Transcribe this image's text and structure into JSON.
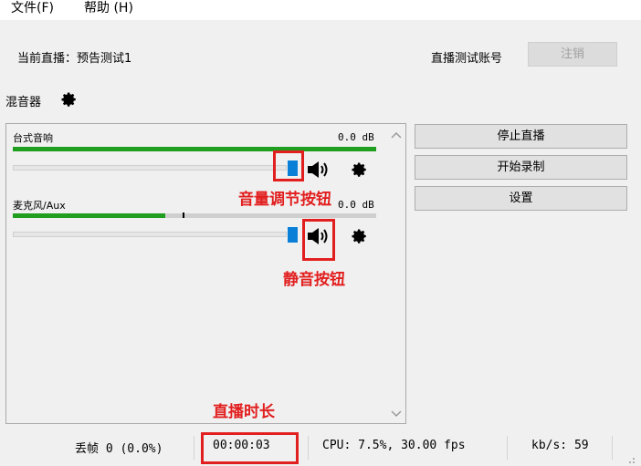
{
  "menu": {
    "file": "文件(F)",
    "help": "帮助 (H)"
  },
  "header": {
    "current_stream": "当前直播：预告测试1",
    "account_label": "直播测试账号",
    "logout_button": "注销"
  },
  "mixer": {
    "title": "混音器",
    "tracks": [
      {
        "name": "台式音响",
        "db": "0.0 dB",
        "level": 1.0
      },
      {
        "name": "麦克风/Aux",
        "db": "0.0 dB",
        "level": 0.42
      }
    ]
  },
  "buttons": {
    "stop_stream": "停止直播",
    "start_record": "开始录制",
    "settings": "设置"
  },
  "annotations": {
    "volume": "音量调节按钮",
    "mute": "静音按钮",
    "duration": "直播时长"
  },
  "status": {
    "dropped_frames": "丢帧 0 (0.0%)",
    "time": "00:00:03",
    "cpu": "CPU: 7.5%, 30.00 fps",
    "kbps": "kb/s: 59"
  },
  "colors": {
    "meter_green": "#1f9e1f",
    "slider_blue": "#0a7fd8",
    "annotation_red": "#e21f1f"
  }
}
